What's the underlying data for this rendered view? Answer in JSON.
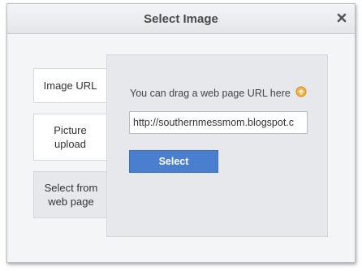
{
  "dialog": {
    "title": "Select Image",
    "close_icon": "close-x-icon"
  },
  "tabs": [
    {
      "label": "Image URL",
      "active": false
    },
    {
      "label": "Picture upload",
      "active": false
    },
    {
      "label": "Select from web page",
      "active": true
    }
  ],
  "panel": {
    "hint": "You can drag a web page URL here",
    "hint_icon": "drag-hand-icon",
    "url_value": "http://southernmessmom.blogspot.c",
    "select_label": "Select"
  },
  "colors": {
    "button": "#4a7fd0",
    "hint_icon": "#f0a020"
  }
}
